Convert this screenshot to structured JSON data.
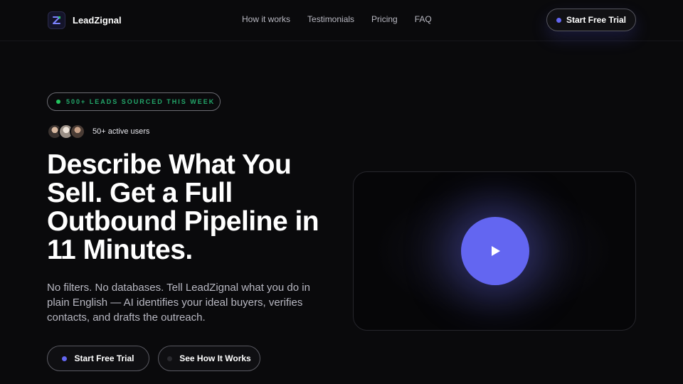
{
  "brand": {
    "name": "LeadZignal",
    "logo_icon": "z-logo-icon"
  },
  "nav": {
    "links": [
      {
        "label": "How it works"
      },
      {
        "label": "Testimonials"
      },
      {
        "label": "Pricing"
      },
      {
        "label": "FAQ"
      }
    ],
    "cta_label": "Start Free Trial"
  },
  "hero": {
    "badge": "500+ LEADS SOURCED THIS WEEK",
    "users_text": "50+ active users",
    "headline": "Describe What You Sell. Get a Full Outbound Pipeline in 11 Minutes.",
    "subtext": "No filters. No databases. Tell LeadZignal what you do in plain English — AI identifies your ideal buyers, verifies contacts, and drafts the outreach.",
    "primary_cta": "Start Free Trial",
    "secondary_cta": "See How It Works"
  },
  "video": {
    "play_icon": "play-icon"
  },
  "colors": {
    "background": "#0a0a0c",
    "accent": "#6366f1",
    "badge_green": "#23a86b",
    "text_muted": "#b8b8c2"
  }
}
